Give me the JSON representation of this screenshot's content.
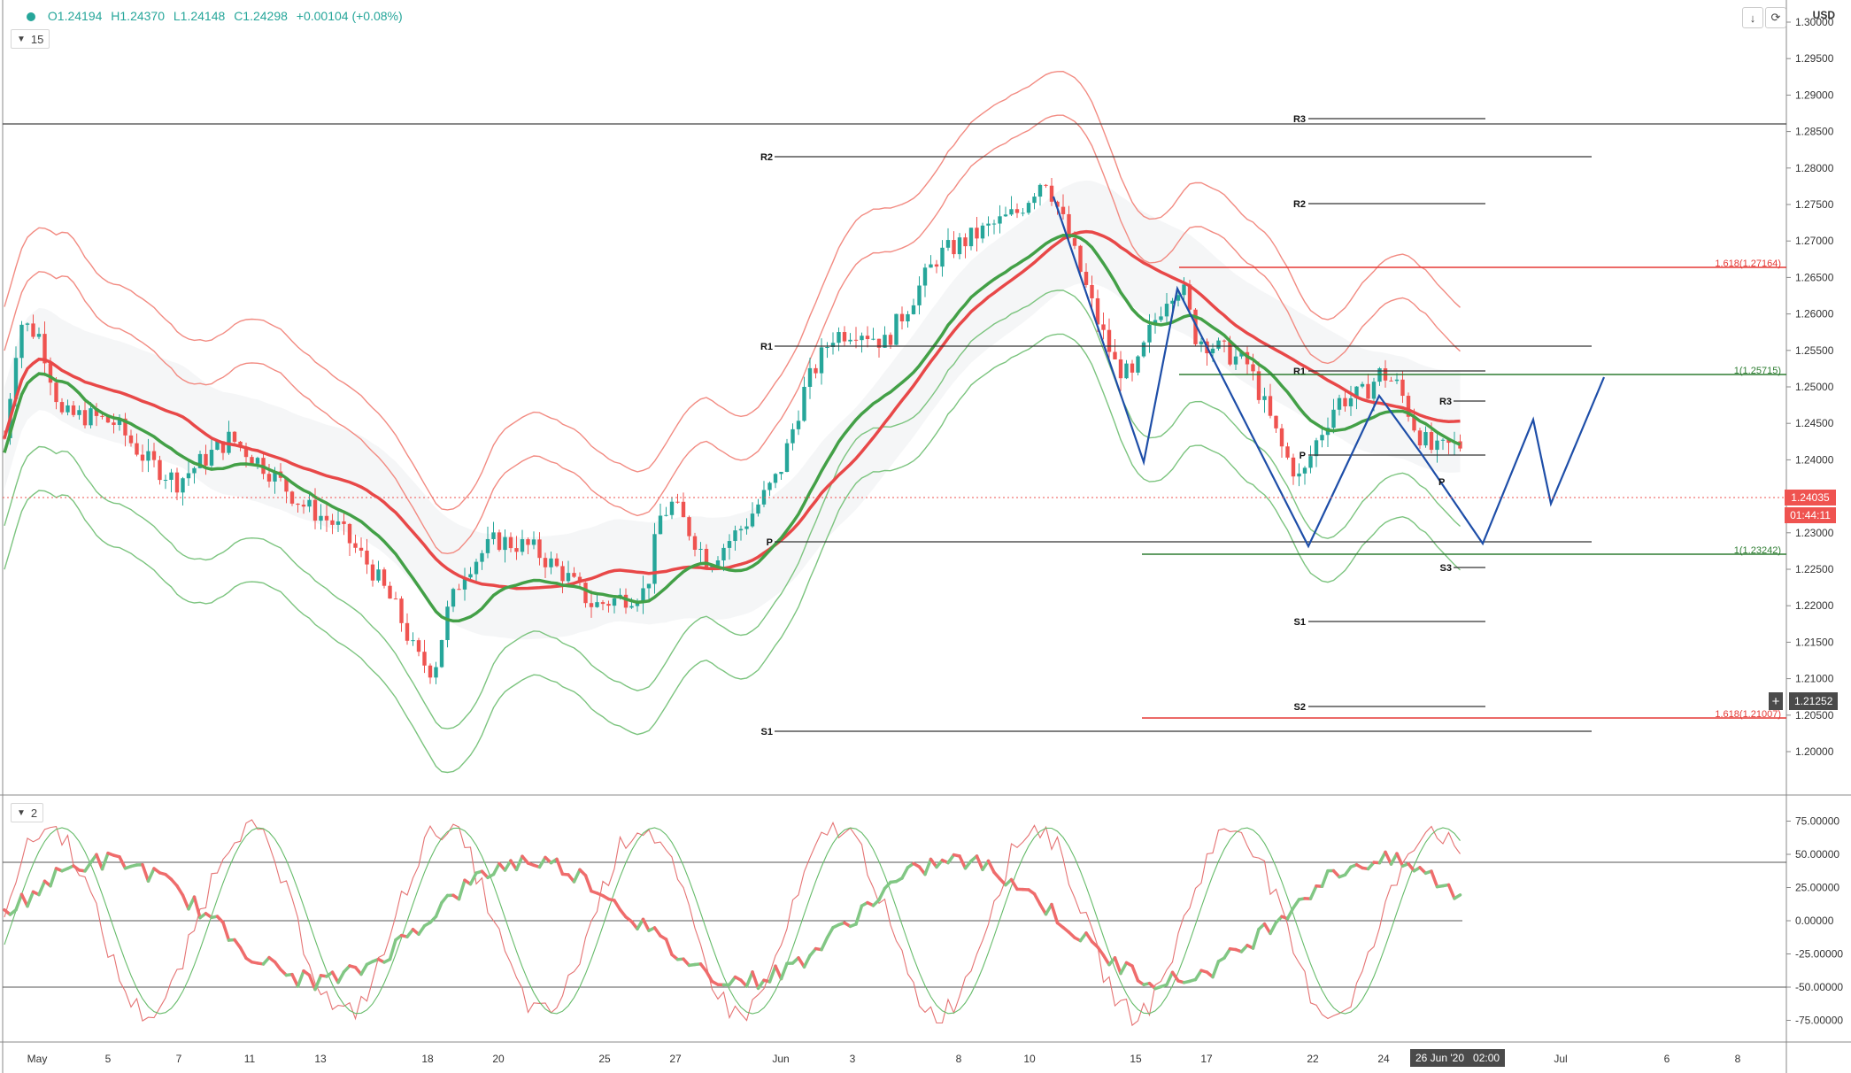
{
  "ohlc": {
    "open": "O1.24194",
    "high": "H1.24370",
    "low": "L1.24148",
    "close": "C1.24298",
    "change": "+0.00104 (+0.08%)"
  },
  "indicators": {
    "main_label": "15",
    "sub_label": "2"
  },
  "currency": "USD",
  "price_axis": [
    "1.30000",
    "1.29500",
    "1.29000",
    "1.28500",
    "1.28000",
    "1.27500",
    "1.27000",
    "1.26500",
    "1.26000",
    "1.25500",
    "1.25000",
    "1.24500",
    "1.24000",
    "1.23500",
    "1.23000",
    "1.22500",
    "1.22000",
    "1.21500",
    "1.21000",
    "1.20500",
    "1.20000"
  ],
  "stoch_axis": [
    "75.00000",
    "50.00000",
    "25.00000",
    "0.00000",
    "-25.00000",
    "-50.00000",
    "-75.00000"
  ],
  "time_axis": [
    "May",
    "5",
    "7",
    "11",
    "13",
    "18",
    "20",
    "25",
    "27",
    "Jun",
    "3",
    "8",
    "10",
    "15",
    "17",
    "22",
    "24",
    "Jul",
    "6",
    "8"
  ],
  "current_price": "1.24035",
  "countdown": "01:44:11",
  "crosshair_price": "1.21252",
  "crosshair_time": "26 Jun '20",
  "crosshair_hour": "02:00",
  "pivot_levels_old": {
    "r2": "R2",
    "r1": "R1",
    "p": "P",
    "s1": "S1"
  },
  "pivot_levels_new": {
    "r3": "R3",
    "r2": "R2",
    "r1": "R1",
    "p": "P",
    "s1": "S1",
    "s2": "S2"
  },
  "pivot_levels_short": {
    "r3": "R3",
    "s3": "S3"
  },
  "fib_labels": {
    "upper_red": "1.618(1.27164)",
    "upper_green": "1(1.25715)",
    "lower_green": "1(1.23242)",
    "lower_red": "1.618(1.21007)"
  },
  "colors": {
    "up": "#26a69a",
    "down": "#ef5350",
    "red_ma": "#e84848",
    "green_ma": "#43a047",
    "band_red": "#f28b82",
    "band_green": "#7cc47f",
    "pattern_blue": "#1e4ea8"
  },
  "icons": {
    "download": "arrow-down-icon",
    "fullscreen": "expand-icon",
    "add": "plus-icon"
  }
}
